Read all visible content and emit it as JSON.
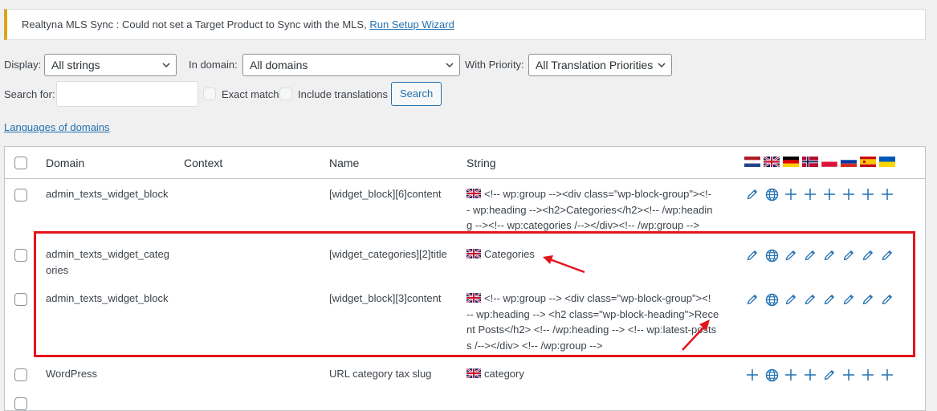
{
  "notice": {
    "message": "Realtyna MLS Sync : Could not set a Target Product to Sync with the MLS,",
    "link": "Run Setup Wizard"
  },
  "filters": {
    "display_label": "Display:",
    "display_value": "All strings",
    "domain_label": "In domain:",
    "domain_value": "All domains",
    "priority_label": "With Priority:",
    "priority_value": "All Translation Priorities",
    "search_label": "Search for:",
    "search_value": "",
    "exact_match": "Exact match",
    "include_translations": "Include translations",
    "search_button": "Search"
  },
  "languages_link": "Languages of domains",
  "table": {
    "columns": [
      "Domain",
      "Context",
      "Name",
      "String"
    ],
    "flags": [
      "nl",
      "gb",
      "de",
      "no",
      "pl",
      "ru",
      "es",
      "ua"
    ],
    "rows": [
      {
        "domain_l1": "admin_texts_widget_block",
        "domain_l2": "",
        "context": "",
        "name": "[widget_block][6]content",
        "string_l1": "<!-- wp:group --><div class=\"wp-block-group\"><!-",
        "string_l2": "- wp:heading --><h2>Categories</h2><!-- /wp:headin",
        "string_l3": "g --><!-- wp:categories /--></div><!-- /wp:group -->",
        "string_l4": ""
      },
      {
        "domain_l1": "admin_texts_widget_categ",
        "domain_l2": "ories",
        "context": "",
        "name": "[widget_categories][2]title",
        "string_l1": "Categories",
        "string_l2": "",
        "string_l3": "",
        "string_l4": ""
      },
      {
        "domain_l1": "admin_texts_widget_block",
        "domain_l2": "",
        "context": "",
        "name": "[widget_block][3]content",
        "string_l1": "<!-- wp:group --> <div class=\"wp-block-group\"><!",
        "string_l2": "-- wp:heading --> <h2 class=\"wp-block-heading\">Rece",
        "string_l3": "nt Posts</h2> <!-- /wp:heading --> <!-- wp:latest-posts",
        "string_l4": "s /--></div> <!-- /wp:group -->"
      },
      {
        "domain_l1": "WordPress",
        "domain_l2": "",
        "context": "",
        "name": "URL category tax slug",
        "string_l1": "category",
        "string_l2": "",
        "string_l3": "",
        "string_l4": ""
      }
    ],
    "row_actions": [
      [
        "pencil-icon",
        "globe-icon",
        "plus-icon",
        "plus-icon",
        "plus-icon",
        "plus-icon",
        "plus-icon",
        "plus-icon"
      ],
      [
        "pencil-icon",
        "globe-icon",
        "pencil-icon",
        "pencil-icon",
        "pencil-icon",
        "pencil-icon",
        "pencil-icon",
        "pencil-icon"
      ],
      [
        "pencil-icon",
        "globe-icon",
        "pencil-icon",
        "pencil-icon",
        "pencil-icon",
        "pencil-icon",
        "pencil-icon",
        "pencil-icon"
      ],
      [
        "plus-icon",
        "globe-icon",
        "plus-icon",
        "plus-icon",
        "pencil-icon",
        "plus-icon",
        "plus-icon",
        "plus-icon"
      ]
    ]
  },
  "colors": {
    "accent": "#2271b1",
    "highlight": "#e3151b",
    "notice_border": "#dba617"
  }
}
